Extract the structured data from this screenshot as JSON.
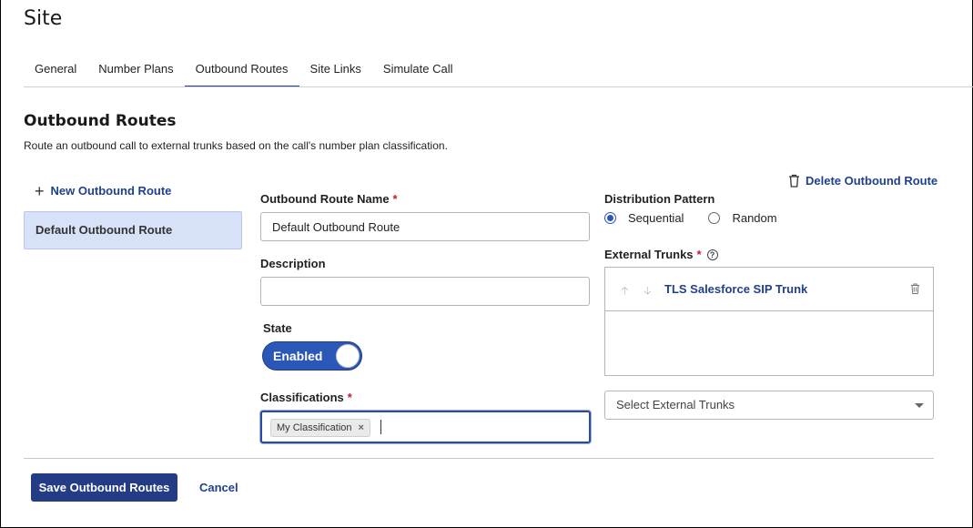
{
  "page": {
    "title": "Site"
  },
  "tabs": [
    {
      "label": "General",
      "active": false
    },
    {
      "label": "Number Plans",
      "active": false
    },
    {
      "label": "Outbound Routes",
      "active": true
    },
    {
      "label": "Site Links",
      "active": false
    },
    {
      "label": "Simulate Call",
      "active": false
    }
  ],
  "section": {
    "title": "Outbound Routes",
    "description": "Route an outbound call to external trunks based on the call's number plan classification."
  },
  "sidebar": {
    "new_route_label": "New Outbound Route",
    "routes": [
      {
        "label": "Default Outbound Route",
        "selected": true
      }
    ]
  },
  "form": {
    "name_label": "Outbound Route Name",
    "name_value": "Default Outbound Route",
    "description_label": "Description",
    "description_value": "",
    "state_label": "State",
    "state_value": "Enabled",
    "classifications_label": "Classifications",
    "classifications": [
      "My Classification"
    ],
    "required_marker": "*"
  },
  "right": {
    "delete_label": "Delete Outbound Route",
    "distribution_label": "Distribution Pattern",
    "distribution_options": [
      {
        "label": "Sequential",
        "selected": true
      },
      {
        "label": "Random",
        "selected": false
      }
    ],
    "trunks_label": "External Trunks",
    "help_glyph": "?",
    "trunks": [
      {
        "name": "TLS Salesforce SIP Trunk"
      }
    ],
    "select_placeholder": "Select External Trunks"
  },
  "footer": {
    "save_label": "Save Outbound Routes",
    "cancel_label": "Cancel"
  },
  "colors": {
    "accent": "#233c85",
    "link": "#1f3f8f",
    "selected_bg": "#d7e1f7",
    "required": "#c0202a"
  }
}
